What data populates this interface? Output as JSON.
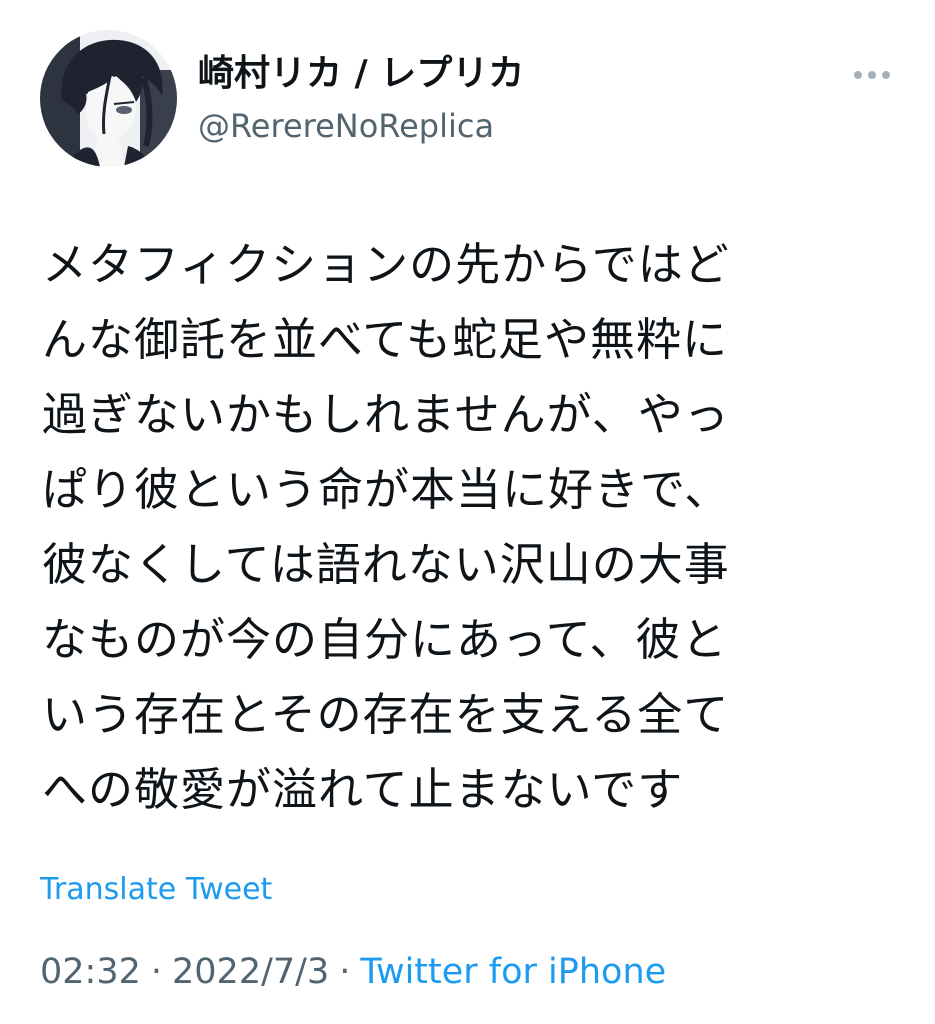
{
  "author": {
    "display_name": "崎村リカ / レプリカ",
    "handle": "@RerereNoReplica",
    "avatar_icon": "user-avatar-illustration"
  },
  "more_icon": "more-options-icon",
  "tweet": {
    "lines": [
      "メタフィクションの先からではど",
      "んな御託を並べても蛇足や無粋に",
      "過ぎないかもしれませんが、やっ",
      "ぱり彼という命が本当に好きで、",
      "彼なくしては語れない沢山の大事",
      "なものが今の自分にあって、彼と",
      "いう存在とその存在を支える全て",
      "への敬愛が溢れて止まないです"
    ]
  },
  "translate_label": "Translate Tweet",
  "meta": {
    "time": "02:32",
    "date": "2022/7/3",
    "separator": "·",
    "source": "Twitter for iPhone"
  },
  "colors": {
    "link": "#1d9bf0",
    "secondary_text": "#536471",
    "primary_text": "#0f1419"
  }
}
